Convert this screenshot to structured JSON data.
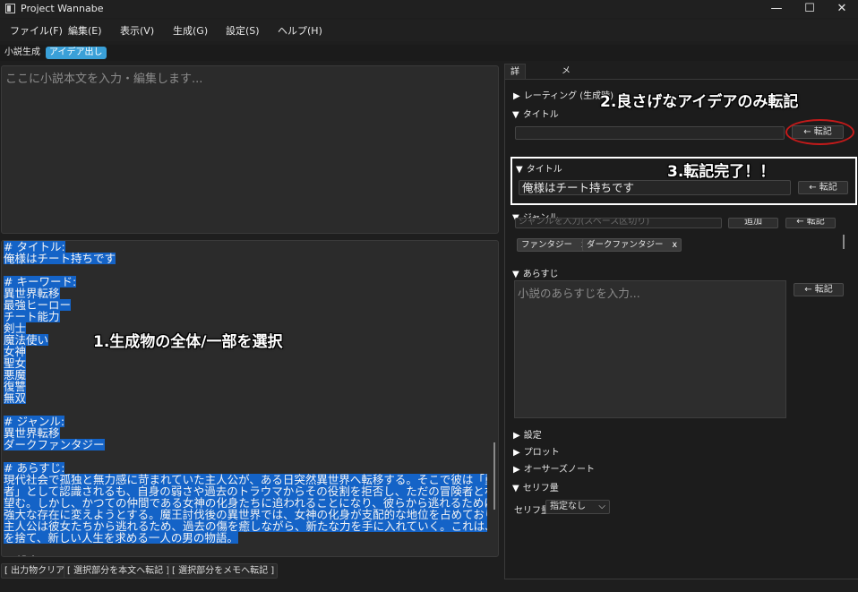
{
  "window": {
    "title": "Project Wannabe",
    "minimize": "—",
    "maximize": "☐",
    "close": "✕"
  },
  "menu": [
    "ファイル(F)",
    "編集(E)",
    "表示(V)",
    "生成(G)",
    "設定(S)",
    "ヘルプ(H)"
  ],
  "mode_tabs": [
    {
      "label": "小説生成",
      "active": false
    },
    {
      "label": "アイデア出し",
      "active": true
    }
  ],
  "editor": {
    "placeholder": "ここに小説本文を入力・編集します..."
  },
  "output": {
    "lines": [
      "# タイトル:",
      "俺様はチート持ちです",
      "",
      "# キーワード:",
      "異世界転移",
      "最強ヒーロー",
      "チート能力",
      "剣士",
      "魔法使い",
      "女神",
      "聖女",
      "悪魔",
      "復讐",
      "無双",
      "",
      "# ジャンル:",
      "異世界転移",
      "ダークファンタジー",
      "",
      "# あらすじ:",
      "現代社会で孤独と無力感に苛まれていた主人公が、ある日突然異世界へ転移する。そこで彼は「勇",
      "者」として認識されるも、自身の弱さや過去のトラウマからその役割を拒否し、ただの冒険者となることを",
      "望む。しかし、かつての仲間である女神の化身たちに追われることになり、彼らから逃れるために自らを",
      "強大な存在に変えようとする。魔王討伐後の異世界では、女神の化身が支配的な地位を占めており、",
      "主人公は彼女たちから逃れるため、過去の傷を癒しながら、新たな力を手に入れていく。これは、過去",
      "を捨て、新しい人生を求める一人の男の物語。",
      "",
      "# 設定:"
    ],
    "selected_line_count": 26
  },
  "annotations": {
    "step1": "1.生成物の全体/一部を選択",
    "step2": "2.良さげなアイデアのみ転記",
    "step3": "3.転記完了！！"
  },
  "bottom_buttons": [
    "[ 出力物クリア ]",
    "[ 選択部分を本文へ転記 ]",
    "[ 選択部分をメモへ転記 ]"
  ],
  "right_tabs": [
    {
      "label": "詳細情報",
      "active": true
    },
    {
      "label": "メモ",
      "active": false
    }
  ],
  "details": {
    "rating_label": "レーティング (生成時)",
    "title_label": "タイトル",
    "transfer_button": "← 転記",
    "title_value": "俺様はチート持ちです",
    "genre_label": "ジャンル",
    "genre_input_placeholder": "ジャンルを入力(スペース区切り)",
    "add_button": "追加",
    "tags": [
      "ファンタジー",
      "ダークファンタジー"
    ],
    "tag_remove": "x",
    "synopsis_label": "あらすじ",
    "synopsis_placeholder": "小説のあらすじを入力...",
    "sections": [
      "設定",
      "プロット",
      "オーサーズノート"
    ],
    "serif_section": "セリフ量",
    "serif_label": "セリフ量:",
    "serif_value": "指定なし"
  }
}
